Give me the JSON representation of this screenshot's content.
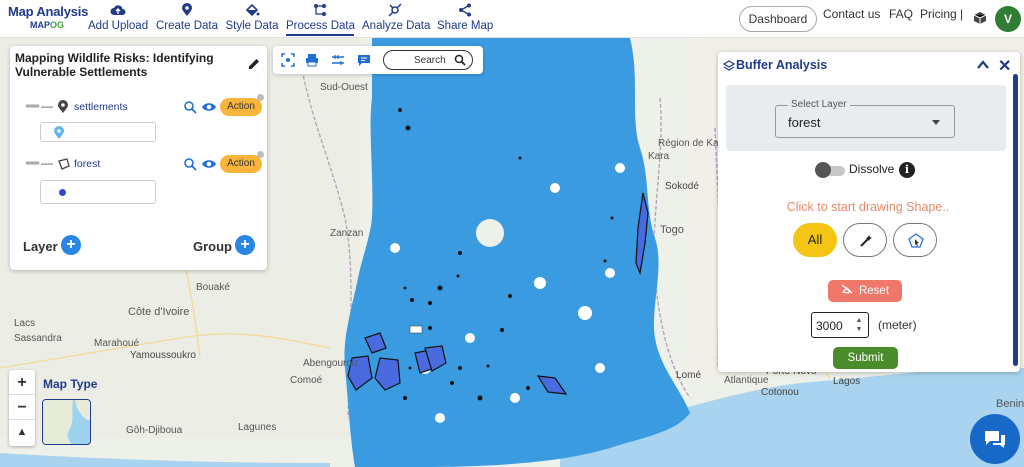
{
  "brand": {
    "title": "Map Analysis",
    "subtitle_main": "MAP",
    "subtitle_accent": "OG"
  },
  "nav": {
    "items": [
      {
        "label": "Add Upload",
        "icon": "cloud-upload-icon"
      },
      {
        "label": "Create Data",
        "icon": "map-pin-icon"
      },
      {
        "label": "Style Data",
        "icon": "paint-bucket-icon"
      },
      {
        "label": "Process Data",
        "icon": "process-nodes-icon"
      },
      {
        "label": "Analyze Data",
        "icon": "analyze-icon"
      },
      {
        "label": "Share Map",
        "icon": "share-icon"
      }
    ],
    "active": "Process Data",
    "dashboard": "Dashboard",
    "contact": "Contact us",
    "faq": "FAQ",
    "pricing": "Pricing |",
    "user_initial": "V"
  },
  "layer_panel": {
    "title": "Mapping Wildlife Risks: Identifying Vulnerable Settlements",
    "layers": [
      {
        "name": "settlements",
        "action": "Action",
        "icon": "point-layer-icon"
      },
      {
        "name": "forest",
        "action": "Action",
        "icon": "polygon-layer-icon"
      }
    ],
    "layer_label": "Layer",
    "group_label": "Group"
  },
  "toolbar": {
    "search_label": "Search"
  },
  "map": {
    "map_type_label": "Map Type",
    "labels": [
      "Sud-Ouest",
      "Zanzan",
      "Bouaké",
      "Côte d'Ivoire",
      "Lacs",
      "Sassandra",
      "Marahoué",
      "Yamoussoukro",
      "Gôh-Djiboua",
      "Abengourou",
      "Comoé",
      "Lagunes",
      "Lomé",
      "Togo",
      "Sokodé",
      "Région de Kara",
      "Porto-Novo",
      "Lagos",
      "Cotonou",
      "Benin",
      "Kara",
      "Atlantique"
    ]
  },
  "buffer_panel": {
    "title": "Buffer Analysis",
    "select_label": "Select Layer",
    "select_value": "forest",
    "dissolve_label": "Dissolve",
    "draw_hint": "Click to start drawing Shape..",
    "all_label": "All",
    "reset_label": "Reset",
    "distance_value": "3000",
    "distance_unit": "(meter)",
    "submit_label": "Submit"
  },
  "colors": {
    "brand_blue": "#1f3b8a",
    "buffer_blue": "#3a9be0",
    "action_orange": "#f9b53b",
    "submit_green": "#4a8c2a",
    "reset_red": "#f0786a",
    "all_yellow": "#f5c514"
  }
}
